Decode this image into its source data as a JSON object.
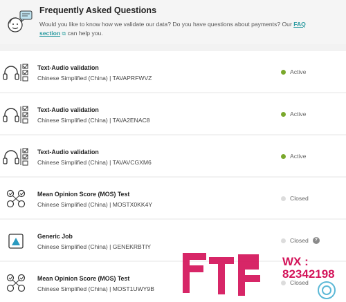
{
  "faq": {
    "title": "Frequently Asked Questions",
    "text_before": "Would you like to know how we validate our data? Do you have questions about payments? Our ",
    "link": "FAQ section",
    "link_icon": "external-link-icon",
    "text_after": " can help you."
  },
  "jobs": [
    {
      "title": "Text-Audio validation",
      "language": "Chinese Simplified (China)",
      "separator": " | ",
      "code": "TAVAPRFWVZ",
      "status": "Active",
      "icon": "headphones-checklist-icon",
      "help": ""
    },
    {
      "title": "Text-Audio validation",
      "language": "Chinese Simplified (China)",
      "separator": " | ",
      "code": "TAVA2ENAC8",
      "status": "Active",
      "icon": "headphones-checklist-icon",
      "help": ""
    },
    {
      "title": "Text-Audio validation",
      "language": "Chinese Simplified (China)",
      "separator": " | ",
      "code": "TAVAVCGXM6",
      "status": "Active",
      "icon": "headphones-checklist-icon",
      "help": ""
    },
    {
      "title": "Mean Opinion Score (MOS) Test",
      "language": "Chinese Simplified (China)",
      "separator": " | ",
      "code": "MOSTX0KK4Y",
      "status": "Closed",
      "icon": "mos-nodes-icon",
      "help": ""
    },
    {
      "title": "Generic Job",
      "language": "Chinese Simplified (China)",
      "separator": " | ",
      "code": "GENEKRBTIY",
      "status": "Closed",
      "icon": "generic-job-icon",
      "help": "?"
    },
    {
      "title": "Mean Opinion Score (MOS) Test",
      "language": "Chinese Simplified (China)",
      "separator": " | ",
      "code": "MOST1UWY9B",
      "status": "Closed",
      "icon": "mos-nodes-icon",
      "help": ""
    }
  ],
  "watermark": {
    "label": "WX :",
    "number": "82342198"
  },
  "colors": {
    "active": "#7aa82c",
    "closed": "#dcdcdc",
    "link": "#2a9aa0",
    "watermark": "#d4145a"
  }
}
